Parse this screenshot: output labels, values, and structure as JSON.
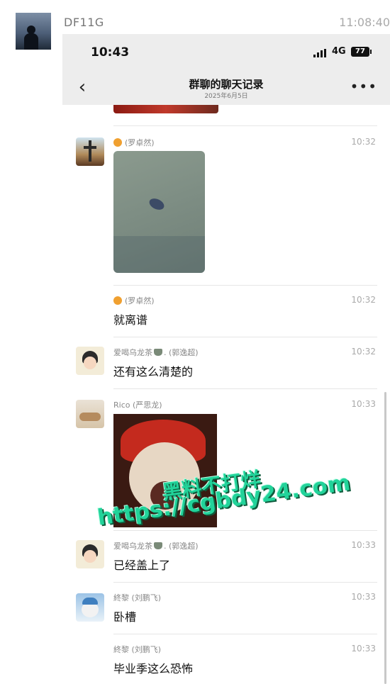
{
  "post": {
    "author": "DF11G",
    "time": "11:08:40"
  },
  "screenshot": {
    "status_bar": {
      "clock": "10:43",
      "network": "4G",
      "battery": "77"
    },
    "nav": {
      "title": "群聊的聊天记录",
      "subtitle": "2025年6月5日"
    },
    "messages": [
      {
        "sender": "(罗卓然)",
        "time": "10:32",
        "text": "",
        "type": "image",
        "avatar_icon": "cross-photo-icon"
      },
      {
        "sender": "(罗卓然)",
        "time": "10:32",
        "text": "就离谱",
        "type": "text",
        "avatar_icon": "cross-photo-icon"
      },
      {
        "sender_prefix": "爱喝乌龙茶",
        "sender_suffix": ". (郭逸超)",
        "time": "10:32",
        "text": "还有这么清楚的",
        "type": "text",
        "avatar_icon": "cartoon-girl-icon"
      },
      {
        "sender": "Rico (严思龙)",
        "time": "10:33",
        "text": "",
        "type": "sticker",
        "avatar_icon": "bed-photo-icon"
      },
      {
        "sender_prefix": "爱喝乌龙茶",
        "sender_suffix": ". (郭逸超)",
        "time": "10:33",
        "text": "已经盖上了",
        "type": "text",
        "avatar_icon": "cartoon-girl-icon"
      },
      {
        "sender": "終黎 (刘鹏飞)",
        "time": "10:33",
        "text": "卧槽",
        "type": "text",
        "avatar_icon": "cat-photo-icon"
      },
      {
        "sender": "終黎 (刘鹏飞)",
        "time": "10:33",
        "text": "毕业季这么恐怖",
        "type": "text",
        "avatar_icon": "none"
      }
    ]
  },
  "watermark": {
    "line1": "黑料不打烊",
    "line2": "https://cgbdy24.com"
  },
  "colors": {
    "header_bg": "#ededed",
    "watermark": "#22d39a"
  }
}
